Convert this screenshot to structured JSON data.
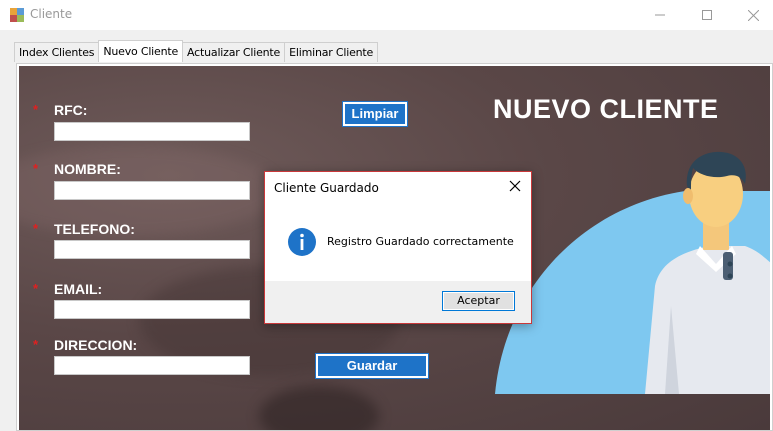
{
  "window": {
    "title": "Cliente",
    "icon": "app-form-icon",
    "controls": {
      "minimize": "minimize-icon",
      "maximize": "maximize-icon",
      "close": "close-icon"
    }
  },
  "tabs": [
    {
      "label": "Index Clientes",
      "active": false
    },
    {
      "label": "Nuevo Cliente",
      "active": true
    },
    {
      "label": "Actualizar Cliente",
      "active": false
    },
    {
      "label": "Eliminar Cliente",
      "active": false
    }
  ],
  "form": {
    "heading": "NUEVO CLIENTE",
    "required_marker": "*",
    "fields": [
      {
        "label": "RFC:",
        "value": ""
      },
      {
        "label": "NOMBRE:",
        "value": ""
      },
      {
        "label": "TELEFONO:",
        "value": ""
      },
      {
        "label": "EMAIL:",
        "value": ""
      },
      {
        "label": "DIRECCION:",
        "value": ""
      }
    ],
    "clear_button": "Limpiar",
    "save_button": "Guardar"
  },
  "dialog": {
    "title": "Cliente Guardado",
    "message": "Registro Guardado correctamente",
    "icon": "info-icon",
    "ok_button": "Aceptar"
  },
  "colors": {
    "accent_blue": "#1e73c8",
    "required_red": "#e02020",
    "dialog_border": "#c9383a",
    "illustration_sky": "#7ec8f0"
  }
}
